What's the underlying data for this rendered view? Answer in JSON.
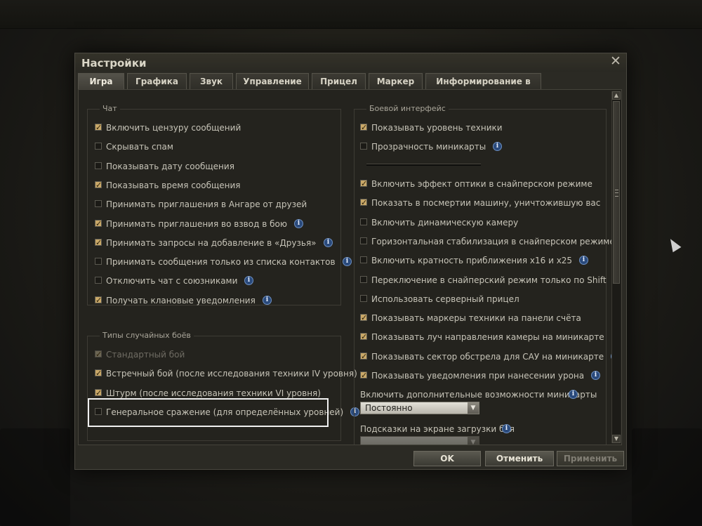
{
  "window": {
    "title": "Настройки",
    "close_glyph": "✕"
  },
  "tabs": [
    {
      "label": "Игра",
      "active": true
    },
    {
      "label": "Графика",
      "active": false
    },
    {
      "label": "Звук",
      "active": false
    },
    {
      "label": "Управление",
      "active": false
    },
    {
      "label": "Прицел",
      "active": false
    },
    {
      "label": "Маркер",
      "active": false
    },
    {
      "label": "Информирование в бою",
      "active": false
    }
  ],
  "chat": {
    "label": "Чат",
    "items": [
      {
        "label": "Включить цензуру сообщений",
        "checked": true,
        "info": false
      },
      {
        "label": "Скрывать спам",
        "checked": false,
        "info": false
      },
      {
        "label": "Показывать дату сообщения",
        "checked": false,
        "info": false
      },
      {
        "label": "Показывать время сообщения",
        "checked": true,
        "info": false
      },
      {
        "label": "Принимать приглашения в Ангаре от друзей",
        "checked": false,
        "info": false
      },
      {
        "label": "Принимать приглашения во взвод в бою",
        "checked": true,
        "info": true
      },
      {
        "label": "Принимать запросы на добавление в «Друзья»",
        "checked": true,
        "info": true
      },
      {
        "label": "Принимать сообщения только из списка контактов",
        "checked": false,
        "info": true
      },
      {
        "label": "Отключить чат с союзниками",
        "checked": false,
        "info": true
      },
      {
        "label": "Получать клановые уведомления",
        "checked": true,
        "info": true
      }
    ]
  },
  "battle_types": {
    "label": "Типы случайных боёв",
    "items": [
      {
        "label": "Стандартный бой",
        "checked": true,
        "disabled": true,
        "info": false
      },
      {
        "label": "Встречный бой (после исследования техники IV уровня)",
        "checked": true,
        "disabled": false,
        "info": false
      },
      {
        "label": "Штурм (после исследования техники VI уровня)",
        "checked": true,
        "disabled": false,
        "info": false
      },
      {
        "label": "Генеральное сражение (для определённых уровней)",
        "checked": false,
        "disabled": false,
        "info": true
      }
    ]
  },
  "battle_interface": {
    "label": "Боевой интерфейс",
    "items_top": [
      {
        "label": "Показывать уровень техники",
        "checked": true,
        "info": false
      },
      {
        "label": "Прозрачность миникарты",
        "checked": false,
        "info": true
      }
    ],
    "items": [
      {
        "label": "Включить эффект оптики в снайперском режиме",
        "checked": true,
        "info": false
      },
      {
        "label": "Показать в посмертии машину, уничтожившую вас",
        "checked": true,
        "info": false
      },
      {
        "label": "Включить динамическую камеру",
        "checked": false,
        "info": false
      },
      {
        "label": "Горизонтальная стабилизация в снайперском режиме",
        "checked": false,
        "info": false
      },
      {
        "label": "Включить кратность приближения x16 и x25",
        "checked": false,
        "info": true
      },
      {
        "label": "Переключение в снайперский режим только по Shift",
        "checked": false,
        "info": false
      },
      {
        "label": "Использовать серверный прицел",
        "checked": false,
        "info": false
      },
      {
        "label": "Показывать маркеры техники на панели счёта",
        "checked": true,
        "info": false
      },
      {
        "label": "Показывать луч направления камеры на миникарте",
        "checked": true,
        "info": true
      },
      {
        "label": "Показывать сектор обстрела для САУ на миникарте",
        "checked": true,
        "info": true
      },
      {
        "label": "Показывать уведомления при нанесении урона",
        "checked": true,
        "info": true
      }
    ],
    "minimap_extra": {
      "label": "Включить дополнительные возможности миникарты",
      "value": "Постоянно"
    },
    "loading_hints": {
      "label": "Подсказки на экране загрузки боя"
    }
  },
  "buttons": {
    "ok": "OK",
    "cancel": "Отменить",
    "apply": "Применить"
  },
  "info_glyph": "i",
  "colors": {
    "accent_check": "#c9a868",
    "info_blue": "#2a4a7c",
    "highlight": "#f1f1f1"
  }
}
